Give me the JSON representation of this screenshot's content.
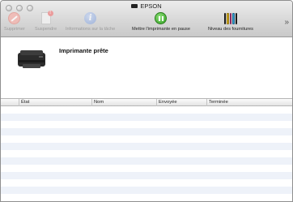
{
  "window": {
    "title": "EPSON",
    "overflow_glyph": "»"
  },
  "toolbar": {
    "items": [
      {
        "label": "Supprimer",
        "icon": "delete-icon",
        "enabled": false
      },
      {
        "label": "Suspendre",
        "icon": "suspend-icon",
        "enabled": false
      },
      {
        "label": "Informations sur la tâche",
        "icon": "info-icon",
        "enabled": false
      },
      {
        "label": "Mettre l'imprimante en pause",
        "icon": "pause-icon",
        "enabled": true
      },
      {
        "label": "Niveau des fournitures",
        "icon": "ink-levels-icon",
        "enabled": true
      }
    ],
    "info_glyph": "i"
  },
  "status": {
    "text": "Imprimante prête"
  },
  "table": {
    "columns": [
      "",
      "État",
      "Nom",
      "Envoyée",
      "Terminée"
    ],
    "rows": []
  },
  "colors": {
    "ink_cartridges": [
      "#2a2a2a",
      "#e0b41c",
      "#d63a8f",
      "#2e9fd6",
      "#2a2a2a"
    ]
  }
}
